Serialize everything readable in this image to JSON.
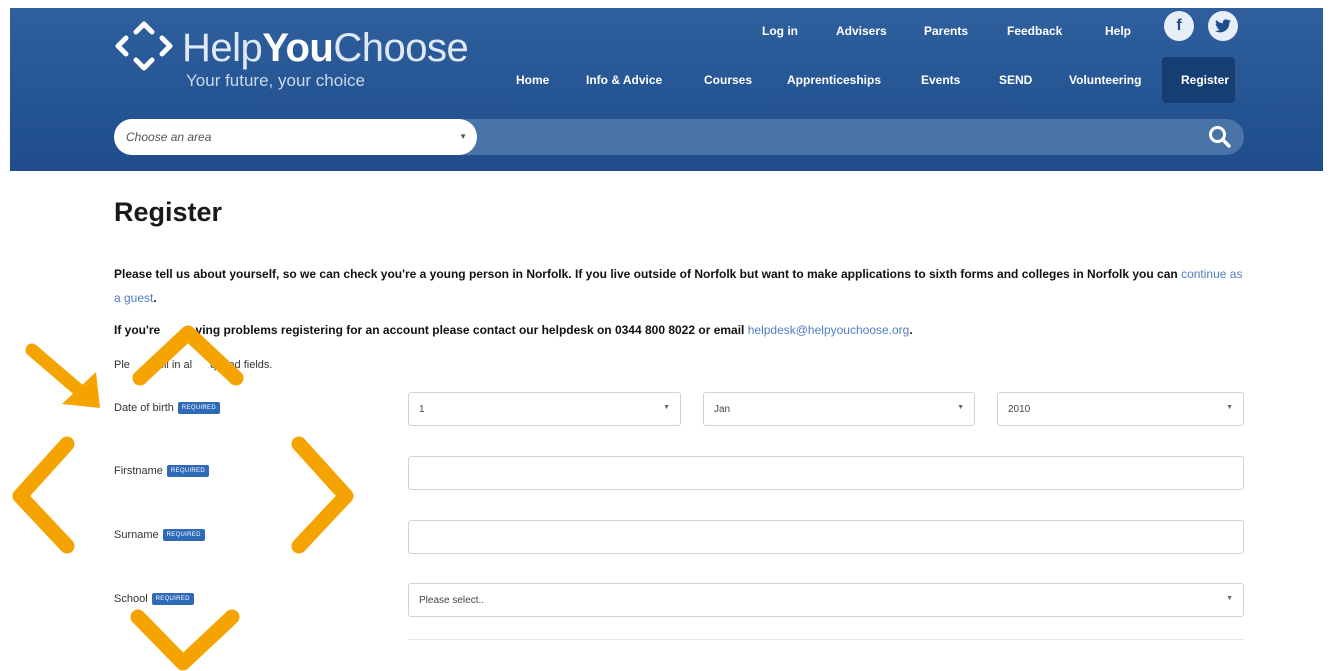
{
  "brand": {
    "name_part1": "Help",
    "name_part2": "You",
    "name_part3": "Choose",
    "tagline": "Your future, your choice",
    "header_color": "#1f4d8c",
    "accent_color": "#f5a300"
  },
  "top_links": [
    "Log in",
    "Advisers",
    "Parents",
    "Feedback",
    "Help"
  ],
  "social": {
    "facebook": "f",
    "twitter": "t"
  },
  "main_nav": [
    "Home",
    "Info & Advice",
    "Courses",
    "Apprenticeships",
    "Events",
    "SEND",
    "Volunteering",
    "Register"
  ],
  "search": {
    "area_placeholder": "Choose an area",
    "icon": "search-icon"
  },
  "page": {
    "title": "Register",
    "intro_text": "Please tell us about yourself, so we can check you're a young person in Norfolk. If you live outside of Norfolk but want to make applications to sixth forms and colleges in Norfolk you can ",
    "guest_link": "continue as a guest",
    "intro_end": ".",
    "help_text_a": "If you're ",
    "help_text_b": "ving problems registering for an account please contact our helpdesk on 0344 800 8022 or email ",
    "help_email": "helpdesk@helpyouchoose.org",
    "help_end": ".",
    "fill_a": "Ple",
    "fill_b": "s fill in al",
    "fill_c": "quired fields."
  },
  "form": {
    "required_badge": "REQUIRED",
    "dob_label": "Date of birth",
    "dob_day": "1",
    "dob_month": "Jan",
    "dob_year": "2010",
    "firstname_label": "Firstname",
    "firstname_value": "",
    "surname_label": "Surname",
    "surname_value": "",
    "school_label": "School",
    "school_value": "Please select.."
  },
  "overlay_icons": [
    "arrow-pointer-icon",
    "chevron-up-icon",
    "chevron-left-icon",
    "chevron-right-icon",
    "chevron-down-icon"
  ]
}
